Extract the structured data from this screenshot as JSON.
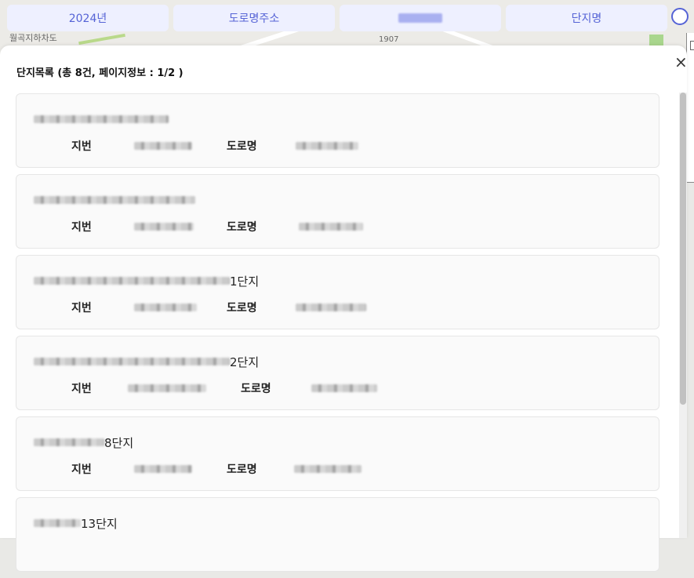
{
  "tabs": {
    "year": "2024년",
    "road_address": "도로명주소",
    "redacted": "",
    "complex_name": "단지명"
  },
  "map": {
    "label": "월곡지하차도",
    "number": "1907"
  },
  "panel": {
    "title": "단지목록 (총 8건, 페이지정보 : 1/2 )",
    "close": "×"
  },
  "labels": {
    "jibun": "지번",
    "road": "도로명"
  },
  "complexes": [
    {
      "name_suffix": ""
    },
    {
      "name_suffix": ""
    },
    {
      "name_suffix": "1단지"
    },
    {
      "name_suffix": "2단지"
    },
    {
      "name_suffix": "8단지"
    },
    {
      "name_suffix": "13단지"
    }
  ],
  "colors": {
    "accent": "#5563d6",
    "tab_bg": "#eef0ff"
  }
}
